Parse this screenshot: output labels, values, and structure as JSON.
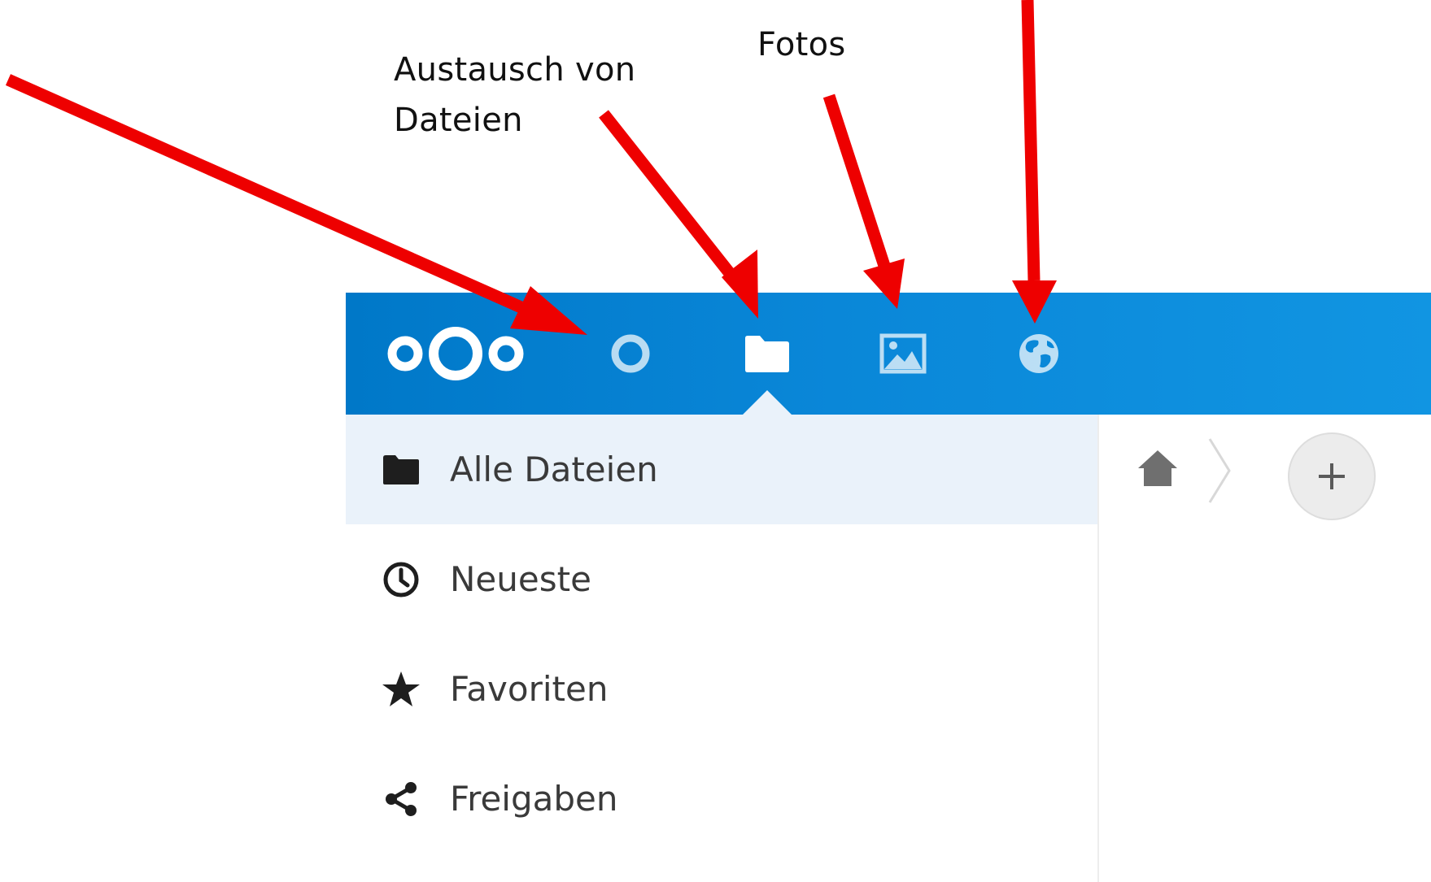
{
  "annotations": {
    "files_label": "Austausch von\nDateien",
    "photos_label": "Fotos",
    "arrow_color": "#ee0000"
  },
  "header": {
    "background_color": "#0082c9",
    "logo": "nextcloud-logo",
    "apps": [
      {
        "name": "activity",
        "icon": "circle-icon",
        "active": false
      },
      {
        "name": "files",
        "icon": "folder-icon",
        "active": true
      },
      {
        "name": "gallery",
        "icon": "image-icon",
        "active": false
      },
      {
        "name": "globe",
        "icon": "globe-icon",
        "active": false
      }
    ]
  },
  "sidebar": {
    "items": [
      {
        "label": "Alle Dateien",
        "icon": "folder-icon",
        "active": true
      },
      {
        "label": "Neueste",
        "icon": "clock-icon",
        "active": false
      },
      {
        "label": "Favoriten",
        "icon": "star-icon",
        "active": false
      },
      {
        "label": "Freigaben",
        "icon": "share-icon",
        "active": false
      }
    ]
  },
  "content": {
    "breadcrumb": {
      "home_icon": "home-icon",
      "separator_icon": "chevron-right-icon"
    },
    "add_button": {
      "label": "+",
      "icon": "plus-icon"
    }
  }
}
